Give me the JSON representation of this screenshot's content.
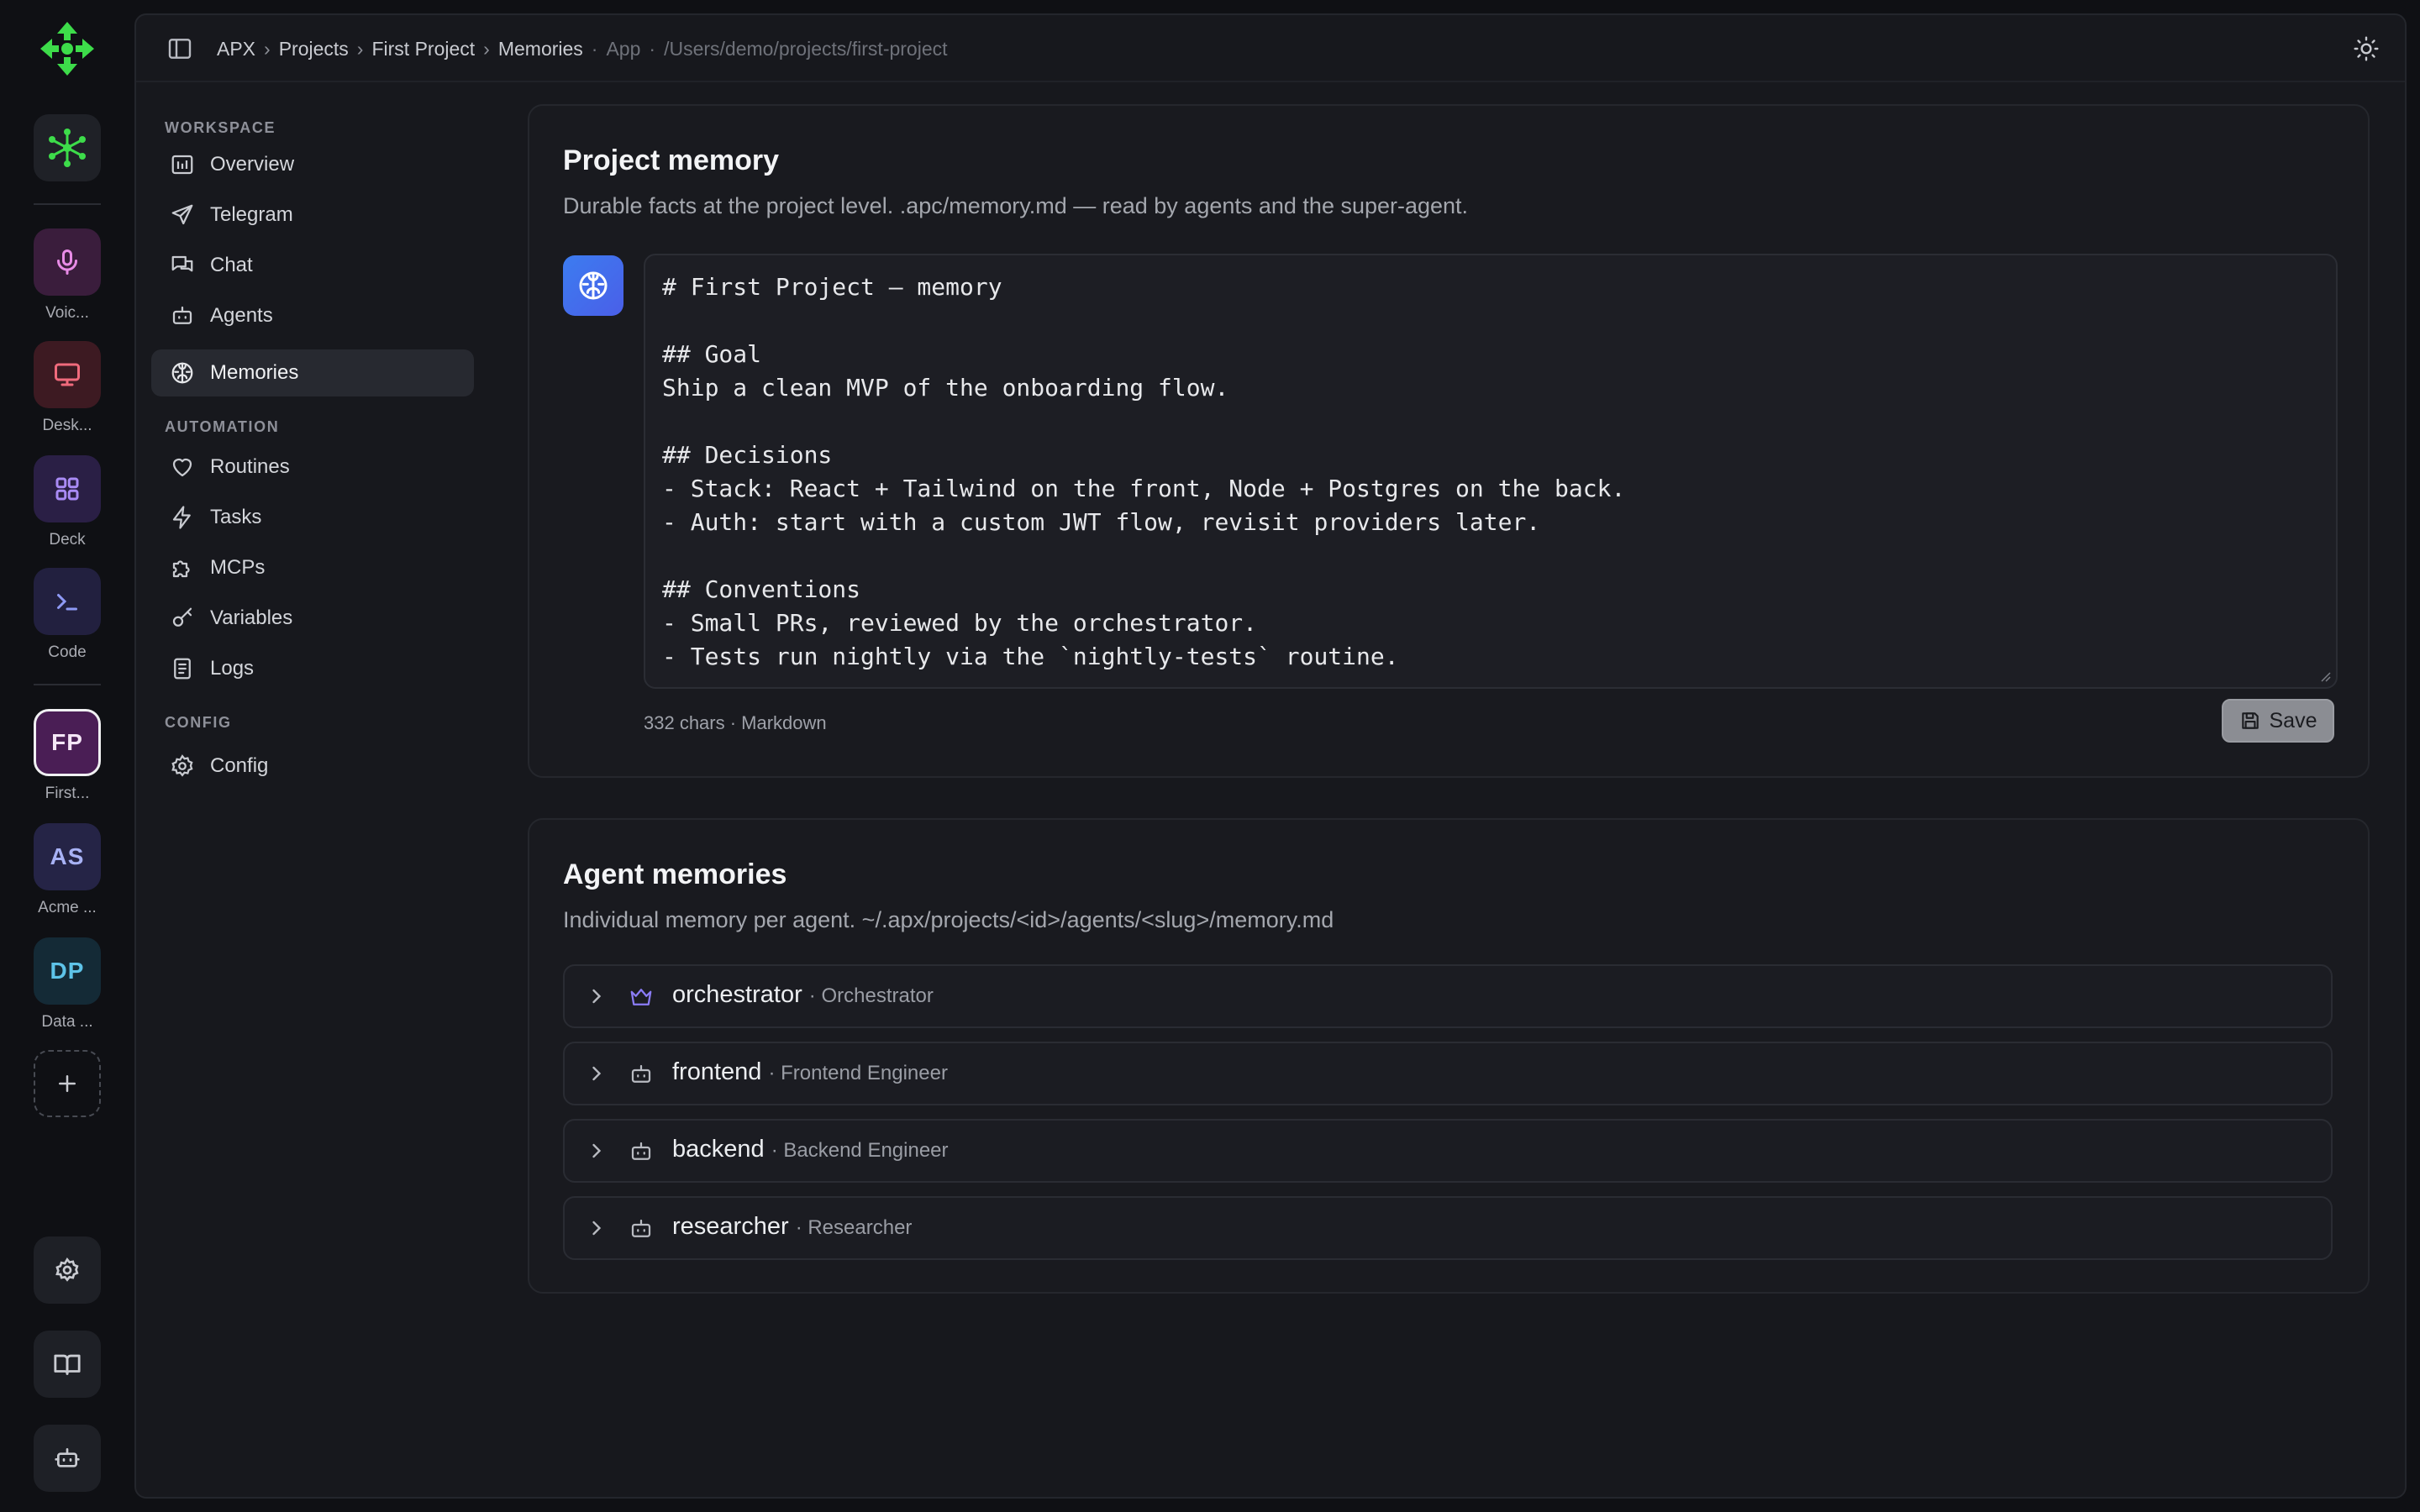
{
  "rail": {
    "items": [
      {
        "label": "Voic...",
        "icon": "microphone-icon"
      },
      {
        "label": "Desk...",
        "icon": "monitor-icon"
      },
      {
        "label": "Deck",
        "icon": "grid-icon"
      },
      {
        "label": "Code",
        "icon": "terminal-icon"
      }
    ],
    "projects": [
      {
        "initials": "FP",
        "label": "First...",
        "active": true
      },
      {
        "initials": "AS",
        "label": "Acme ..."
      },
      {
        "initials": "DP",
        "label": "Data ..."
      }
    ],
    "add_icon": "plus-icon",
    "bottom_icons": [
      "gear-icon",
      "book-icon",
      "robot-icon"
    ]
  },
  "topbar": {
    "crumbs": [
      "APX",
      "Projects",
      "First Project",
      "Memories"
    ],
    "separator": "›",
    "app_label": "App",
    "path": "/Users/demo/projects/first-project",
    "dot": "·"
  },
  "nav": {
    "workspace_label": "WORKSPACE",
    "workspace_items": [
      {
        "label": "Overview",
        "icon": "overview-icon"
      },
      {
        "label": "Telegram",
        "icon": "send-icon"
      },
      {
        "label": "Chat",
        "icon": "chat-icon"
      },
      {
        "label": "Agents",
        "icon": "robot-icon"
      },
      {
        "label": "Memories",
        "icon": "brain-icon",
        "active": true
      }
    ],
    "automation_label": "AUTOMATION",
    "automation_items": [
      {
        "label": "Routines",
        "icon": "heart-icon"
      },
      {
        "label": "Tasks",
        "icon": "bolt-icon"
      },
      {
        "label": "MCPs",
        "icon": "puzzle-icon"
      },
      {
        "label": "Variables",
        "icon": "key-icon"
      },
      {
        "label": "Logs",
        "icon": "logs-icon"
      }
    ],
    "config_label": "CONFIG",
    "config_items": [
      {
        "label": "Config",
        "icon": "gear-icon"
      }
    ]
  },
  "project_memory": {
    "title": "Project memory",
    "subtitle": "Durable facts at the project level. .apc/memory.md — read by agents and the super-agent.",
    "content": "# First Project — memory\n\n## Goal\nShip a clean MVP of the onboarding flow.\n\n## Decisions\n- Stack: React + Tailwind on the front, Node + Postgres on the back.\n- Auth: start with a custom JWT flow, revisit providers later.\n\n## Conventions\n- Small PRs, reviewed by the orchestrator.\n- Tests run nightly via the `nightly-tests` routine.",
    "meta": "332 chars · Markdown",
    "save_label": "Save"
  },
  "agent_memories": {
    "title": "Agent memories",
    "subtitle": "Individual memory per agent. ~/.apx/projects/<id>/agents/<slug>/memory.md",
    "agents": [
      {
        "name": "orchestrator",
        "role": "· Orchestrator",
        "icon": "crown-icon"
      },
      {
        "name": "frontend",
        "role": "· Frontend Engineer",
        "icon": "robot-icon"
      },
      {
        "name": "backend",
        "role": "· Backend Engineer",
        "icon": "robot-icon"
      },
      {
        "name": "researcher",
        "role": "· Researcher",
        "icon": "robot-icon"
      }
    ]
  },
  "colors": {
    "accent_green": "#3ddc4a",
    "brain_blue": "#3c7cf0",
    "crown_purple": "#8b7cf6"
  }
}
